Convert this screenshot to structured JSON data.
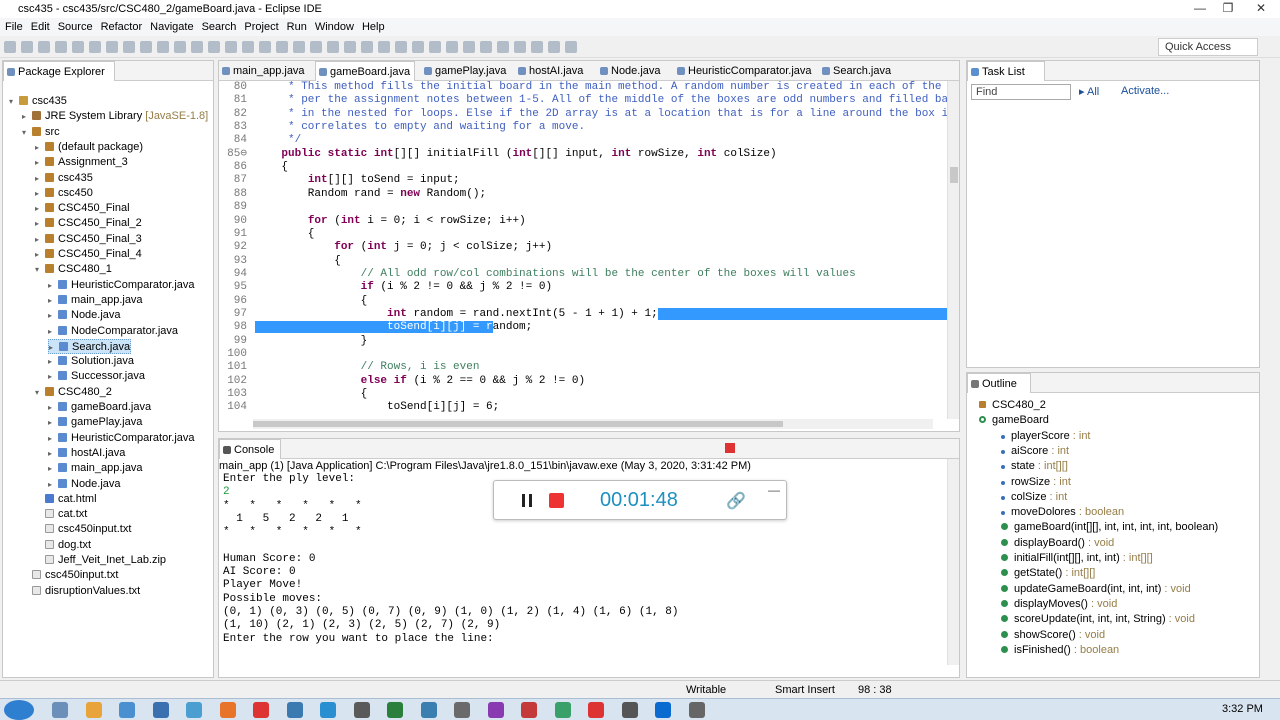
{
  "window": {
    "title": "csc435 - csc435/src/CSC480_2/gameBoard.java - Eclipse IDE",
    "minimize": "—",
    "maximize": "❐",
    "close": "✕"
  },
  "menu": [
    "File",
    "Edit",
    "Source",
    "Refactor",
    "Navigate",
    "Search",
    "Project",
    "Run",
    "Window",
    "Help"
  ],
  "toolbar": {
    "quick_access": "Quick Access"
  },
  "package_explorer": {
    "title": "Package Explorer",
    "items": [
      {
        "label": "csc435",
        "indent": 0,
        "icon": "project-icon",
        "arrow": "▾"
      },
      {
        "label": "JRE System Library",
        "suffix": " [JavaSE-1.8]",
        "indent": 1,
        "icon": "library-icon",
        "arrow": "▸"
      },
      {
        "label": "src",
        "indent": 1,
        "icon": "source-folder-icon",
        "arrow": "▾"
      },
      {
        "label": "(default package)",
        "indent": 2,
        "icon": "package-icon",
        "arrow": "▸"
      },
      {
        "label": "Assignment_3",
        "indent": 2,
        "icon": "package-icon",
        "arrow": "▸"
      },
      {
        "label": "csc435",
        "indent": 2,
        "icon": "package-icon",
        "arrow": "▸"
      },
      {
        "label": "csc450",
        "indent": 2,
        "icon": "package-icon",
        "arrow": "▸"
      },
      {
        "label": "CSC450_Final",
        "indent": 2,
        "icon": "package-icon",
        "arrow": "▸"
      },
      {
        "label": "CSC450_Final_2",
        "indent": 2,
        "icon": "package-icon",
        "arrow": "▸"
      },
      {
        "label": "CSC450_Final_3",
        "indent": 2,
        "icon": "package-icon",
        "arrow": "▸"
      },
      {
        "label": "CSC450_Final_4",
        "indent": 2,
        "icon": "package-icon",
        "arrow": "▸"
      },
      {
        "label": "CSC480_1",
        "indent": 2,
        "icon": "package-icon",
        "arrow": "▾"
      },
      {
        "label": "HeuristicComparator.java",
        "indent": 3,
        "icon": "java-file-icon",
        "arrow": "▸"
      },
      {
        "label": "main_app.java",
        "indent": 3,
        "icon": "java-file-icon",
        "arrow": "▸"
      },
      {
        "label": "Node.java",
        "indent": 3,
        "icon": "java-file-icon",
        "arrow": "▸"
      },
      {
        "label": "NodeComparator.java",
        "indent": 3,
        "icon": "java-file-icon",
        "arrow": "▸"
      },
      {
        "label": "Search.java",
        "indent": 3,
        "icon": "java-file-icon",
        "arrow": "▸",
        "selected": true
      },
      {
        "label": "Solution.java",
        "indent": 3,
        "icon": "java-file-icon",
        "arrow": "▸"
      },
      {
        "label": "Successor.java",
        "indent": 3,
        "icon": "java-file-icon",
        "arrow": "▸"
      },
      {
        "label": "CSC480_2",
        "indent": 2,
        "icon": "package-icon",
        "arrow": "▾"
      },
      {
        "label": "gameBoard.java",
        "indent": 3,
        "icon": "java-file-icon",
        "arrow": "▸"
      },
      {
        "label": "gamePlay.java",
        "indent": 3,
        "icon": "java-file-icon",
        "arrow": "▸"
      },
      {
        "label": "HeuristicComparator.java",
        "indent": 3,
        "icon": "java-file-icon",
        "arrow": "▸"
      },
      {
        "label": "hostAI.java",
        "indent": 3,
        "icon": "java-file-icon",
        "arrow": "▸"
      },
      {
        "label": "main_app.java",
        "indent": 3,
        "icon": "java-file-icon",
        "arrow": "▸"
      },
      {
        "label": "Node.java",
        "indent": 3,
        "icon": "java-file-icon",
        "arrow": "▸"
      },
      {
        "label": "cat.html",
        "indent": 2,
        "icon": "html-file-icon",
        "arrow": ""
      },
      {
        "label": "cat.txt",
        "indent": 2,
        "icon": "text-file-icon",
        "arrow": ""
      },
      {
        "label": "csc450input.txt",
        "indent": 2,
        "icon": "text-file-icon",
        "arrow": ""
      },
      {
        "label": "dog.txt",
        "indent": 2,
        "icon": "text-file-icon",
        "arrow": ""
      },
      {
        "label": "Jeff_Veit_Inet_Lab.zip",
        "indent": 2,
        "icon": "zip-file-icon",
        "arrow": ""
      },
      {
        "label": "csc450input.txt",
        "indent": 1,
        "icon": "text-file-icon",
        "arrow": ""
      },
      {
        "label": "disruptionValues.txt",
        "indent": 1,
        "icon": "text-file-icon",
        "arrow": ""
      }
    ]
  },
  "editor": {
    "tabs": [
      {
        "label": "main_app.java"
      },
      {
        "label": "gameBoard.java",
        "active": true
      },
      {
        "label": "gamePlay.java"
      },
      {
        "label": "hostAI.java"
      },
      {
        "label": "Node.java"
      },
      {
        "label": "HeuristicComparator.java"
      },
      {
        "label": "Search.java"
      }
    ],
    "lines": [
      {
        "n": "80",
        "text": "     * This method fills the initial board in the main method. A random number is created in each of the boxes",
        "kind": "jd"
      },
      {
        "n": "81",
        "text": "     * per the assignment notes between 1-5. All of the middle of the boxes are odd numbers and filled based on the",
        "kind": "jd"
      },
      {
        "n": "82",
        "text": "     * in the nested for loops. Else if the 2D array is at a location that is for a line around the box it sets it",
        "kind": "jd"
      },
      {
        "n": "83",
        "text": "     * correlates to empty and waiting for a move.",
        "kind": "jd"
      },
      {
        "n": "84",
        "text": "     */",
        "kind": "jd"
      },
      {
        "n": "85⊖",
        "text": "    public static int[][] initialFill (int[][] input, int rowSize, int colSize)",
        "kind": "code"
      },
      {
        "n": "86",
        "text": "    {",
        "kind": "code"
      },
      {
        "n": "87",
        "text": "        int[][] toSend = input;",
        "kind": "code"
      },
      {
        "n": "88",
        "text": "        Random rand = new Random();",
        "kind": "code"
      },
      {
        "n": "89",
        "text": "",
        "kind": "code"
      },
      {
        "n": "90",
        "text": "        for (int i = 0; i < rowSize; i++)",
        "kind": "code"
      },
      {
        "n": "91",
        "text": "        {",
        "kind": "code"
      },
      {
        "n": "92",
        "text": "            for (int j = 0; j < colSize; j++)",
        "kind": "code"
      },
      {
        "n": "93",
        "text": "            {",
        "kind": "code"
      },
      {
        "n": "94",
        "text": "                // All odd row/col combinations will be the center of the boxes will values",
        "kind": "cm"
      },
      {
        "n": "95",
        "text": "                if (i % 2 != 0 && j % 2 != 0)",
        "kind": "code"
      },
      {
        "n": "96",
        "text": "                {",
        "kind": "code"
      },
      {
        "n": "97",
        "text": "                    int random = rand.nextInt(5 - 1 + 1) + 1;",
        "kind": "code"
      },
      {
        "n": "98",
        "text": "                    toSend[i][j] = random;",
        "kind": "code"
      },
      {
        "n": "99",
        "text": "                }",
        "kind": "code"
      },
      {
        "n": "100",
        "text": "",
        "kind": "code"
      },
      {
        "n": "101",
        "text": "                // Rows, i is even",
        "kind": "cm"
      },
      {
        "n": "102",
        "text": "                else if (i % 2 == 0 && j % 2 != 0)",
        "kind": "code"
      },
      {
        "n": "103",
        "text": "                {",
        "kind": "code"
      },
      {
        "n": "104",
        "text": "                    toSend[i][j] = 6;",
        "kind": "code"
      }
    ]
  },
  "console": {
    "title": "Console",
    "header": "main_app (1) [Java Application] C:\\Program Files\\Java\\jre1.8.0_151\\bin\\javaw.exe (May 3, 2020, 3:31:42 PM)",
    "lines": [
      "Enter the ply level:",
      "2",
      "*   *   *   *   *   *",
      "  1   5   2   2   1",
      "*   *   *   *   *   *",
      "",
      "Human Score: 0",
      "AI Score: 0",
      "Player Move!",
      "Possible moves:",
      "(0, 1) (0, 3) (0, 5) (0, 7) (0, 9) (1, 0) (1, 2) (1, 4) (1, 6) (1, 8)",
      "(1, 10) (2, 1) (2, 3) (2, 5) (2, 7) (2, 9)",
      "Enter the row you want to place the line:"
    ]
  },
  "recorder": {
    "time": "00:01:48",
    "collapse": "—"
  },
  "task_list": {
    "title": "Task List",
    "find_placeholder": "Find",
    "all": "All",
    "activate": "Activate..."
  },
  "outline": {
    "title": "Outline",
    "items": [
      {
        "label": "CSC480_2",
        "type": "",
        "indent": 0,
        "kind": "package"
      },
      {
        "label": "gameBoard",
        "type": "",
        "indent": 0,
        "kind": "class"
      },
      {
        "label": "playerScore",
        "type": " : int",
        "indent": 1,
        "kind": "field"
      },
      {
        "label": "aiScore",
        "type": " : int",
        "indent": 1,
        "kind": "field"
      },
      {
        "label": "state",
        "type": " : int[][]",
        "indent": 1,
        "kind": "field"
      },
      {
        "label": "rowSize",
        "type": " : int",
        "indent": 1,
        "kind": "field"
      },
      {
        "label": "colSize",
        "type": " : int",
        "indent": 1,
        "kind": "field"
      },
      {
        "label": "moveDolores",
        "type": " : boolean",
        "indent": 1,
        "kind": "field"
      },
      {
        "label": "gameBoard(int[][], int, int, int, int, boolean)",
        "type": "",
        "indent": 1,
        "kind": "method"
      },
      {
        "label": "displayBoard()",
        "type": " : void",
        "indent": 1,
        "kind": "method"
      },
      {
        "label": "initialFill(int[][], int, int)",
        "type": " : int[][]",
        "indent": 1,
        "kind": "method"
      },
      {
        "label": "getState()",
        "type": " : int[][]",
        "indent": 1,
        "kind": "method"
      },
      {
        "label": "updateGameBoard(int, int, int)",
        "type": " : void",
        "indent": 1,
        "kind": "method"
      },
      {
        "label": "displayMoves()",
        "type": " : void",
        "indent": 1,
        "kind": "method"
      },
      {
        "label": "scoreUpdate(int, int, int, String)",
        "type": " : void",
        "indent": 1,
        "kind": "method"
      },
      {
        "label": "showScore()",
        "type": " : void",
        "indent": 1,
        "kind": "method"
      },
      {
        "label": "isFinished()",
        "type": " : boolean",
        "indent": 1,
        "kind": "method"
      }
    ]
  },
  "status": {
    "mode": "Writable",
    "insert": "Smart Insert",
    "position": "98 : 38"
  },
  "taskbar": {
    "time": "3:32 PM"
  }
}
